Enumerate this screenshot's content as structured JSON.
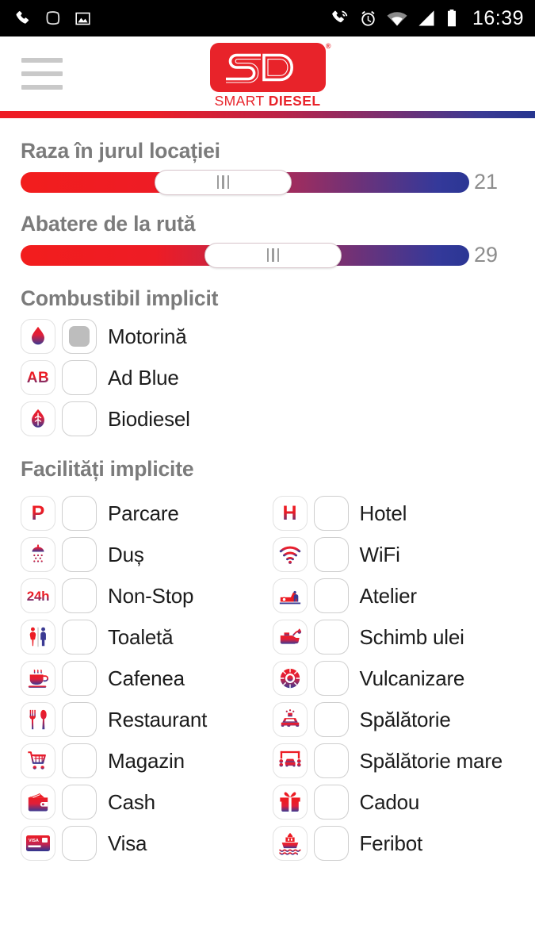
{
  "status_bar": {
    "left_icons": [
      "phone-icon",
      "rounded-square-icon",
      "image-icon"
    ],
    "right_icons": [
      "phone-call-waves-icon",
      "alarm-clock-icon",
      "wifi-icon",
      "signal-icon",
      "battery-icon"
    ],
    "time": "16:39"
  },
  "app_bar": {
    "menu_icon": "hamburger-menu-icon",
    "logo": {
      "monogram": "SD",
      "word_1": "SMART",
      "word_2": "DIESEL",
      "registered": "®"
    }
  },
  "colors": {
    "brand_red": "#ec1c24",
    "brand_blue": "#2b3694",
    "heading_gray": "#7b7b7b",
    "label_black": "#1c1c1c",
    "value_gray": "#8d8d8d"
  },
  "sliders": [
    {
      "title": "Raza în jurul locației",
      "value": "21",
      "thumb_left_pct": 29.8,
      "thumb_width_pct": 30.6
    },
    {
      "title": "Abatere de la rută",
      "value": "29",
      "thumb_left_pct": 41.0,
      "thumb_width_pct": 30.6
    }
  ],
  "fuel_section": {
    "title": "Combustibil implicit",
    "options": [
      {
        "icon": "fuel-drop-icon",
        "label": "Motorină",
        "selected": true
      },
      {
        "icon": "ad-blue-icon",
        "label": "Ad Blue",
        "selected": false,
        "badge_text": "AB"
      },
      {
        "icon": "biodiesel-leaf-icon",
        "label": "Biodiesel",
        "selected": false
      }
    ]
  },
  "facilities_section": {
    "title": "Facilități implicite",
    "left_column": [
      {
        "icon": "parking-icon",
        "label": "Parcare",
        "selected": false,
        "badge_text": "P"
      },
      {
        "icon": "shower-icon",
        "label": "Duș",
        "selected": false
      },
      {
        "icon": "non-stop-24h-icon",
        "label": "Non-Stop",
        "selected": false,
        "badge_text": "24h"
      },
      {
        "icon": "toilet-icon",
        "label": "Toaletă",
        "selected": false
      },
      {
        "icon": "coffee-cup-icon",
        "label": "Cafenea",
        "selected": false
      },
      {
        "icon": "restaurant-cutlery-icon",
        "label": "Restaurant",
        "selected": false
      },
      {
        "icon": "shopping-cart-icon",
        "label": "Magazin",
        "selected": false
      },
      {
        "icon": "wallet-cash-icon",
        "label": "Cash",
        "selected": false
      },
      {
        "icon": "visa-card-icon",
        "label": "Visa",
        "selected": false,
        "badge_text": "VISA"
      }
    ],
    "right_column": [
      {
        "icon": "hotel-icon",
        "label": "Hotel",
        "selected": false,
        "badge_text": "H"
      },
      {
        "icon": "wifi-icon",
        "label": "WiFi",
        "selected": false
      },
      {
        "icon": "workshop-icon",
        "label": "Atelier",
        "selected": false
      },
      {
        "icon": "oil-change-icon",
        "label": "Schimb ulei",
        "selected": false
      },
      {
        "icon": "tire-service-icon",
        "label": "Vulcanizare",
        "selected": false
      },
      {
        "icon": "car-wash-icon",
        "label": "Spălătorie",
        "selected": false
      },
      {
        "icon": "truck-wash-icon",
        "label": "Spălătorie mare",
        "selected": false
      },
      {
        "icon": "gift-icon",
        "label": "Cadou",
        "selected": false
      },
      {
        "icon": "ferry-boat-icon",
        "label": "Feribot",
        "selected": false
      }
    ]
  }
}
